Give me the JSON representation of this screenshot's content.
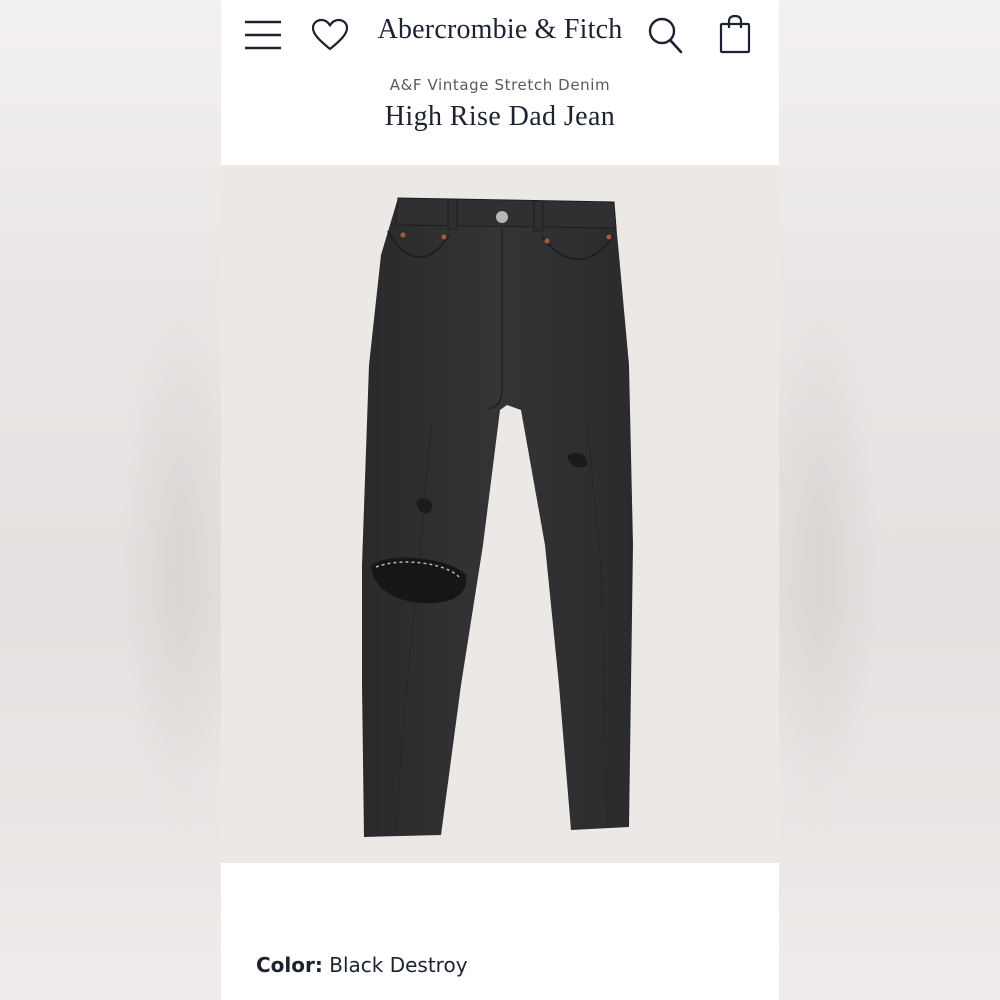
{
  "header": {
    "brand": "Abercrombie & Fitch",
    "icons": [
      "menu-icon",
      "heart-icon",
      "search-icon",
      "shopping-bag-icon"
    ]
  },
  "product": {
    "collection": "A&F Vintage Stretch Denim",
    "title": "High Rise Dad Jean",
    "color_label": "Color:",
    "color_value": "Black Destroy"
  },
  "colors": {
    "text": "#1c2230",
    "denim": "#2e2e30",
    "image_background": "#ece8e6"
  }
}
